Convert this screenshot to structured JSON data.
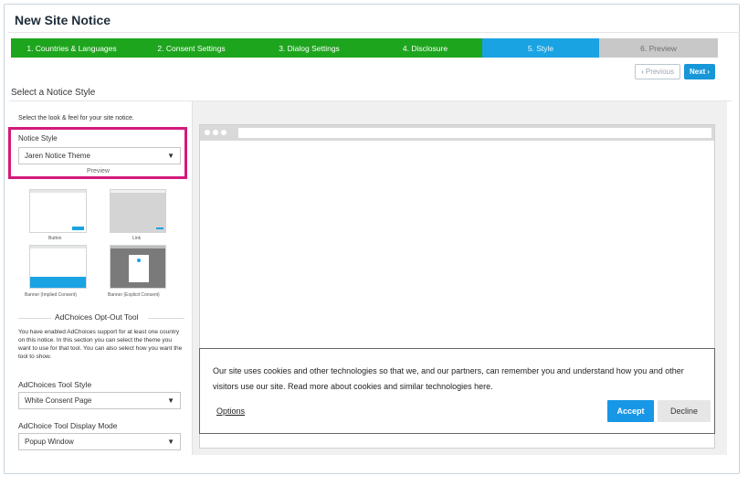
{
  "window": {
    "title": "New Site Notice"
  },
  "steps": [
    {
      "label": "1. Countries & Languages",
      "state": "done"
    },
    {
      "label": "2. Consent Settings",
      "state": "done"
    },
    {
      "label": "3. Dialog Settings",
      "state": "done"
    },
    {
      "label": "4. Disclosure",
      "state": "done"
    },
    {
      "label": "5. Style",
      "state": "active"
    },
    {
      "label": "6. Preview",
      "state": "todo"
    }
  ],
  "nav": {
    "previous_label": "Previous",
    "next_label": "Next"
  },
  "section": {
    "title": "Select a Notice Style",
    "description": "Select the look & feel for your site notice."
  },
  "notice_style": {
    "label": "Notice Style",
    "selected": "Jaren Notice Theme",
    "preview_label": "Preview",
    "thumbnails": [
      {
        "caption": "Button"
      },
      {
        "caption": "Link"
      },
      {
        "caption": "Banner (Implied Consent)"
      },
      {
        "caption": "Banner (Explicit Consent)"
      }
    ]
  },
  "adchoices": {
    "title": "AdChoices Opt-Out Tool",
    "description": "You have enabled AdChoices support for at least one country on this notice. In this section you can select the theme you want to use for that tool. You can also select how you want the tool to show.",
    "tool_style_label": "AdChoices Tool Style",
    "tool_style_value": "White Consent Page",
    "display_mode_label": "AdChoice Tool Display Mode",
    "display_mode_value": "Popup Window"
  },
  "preview": {
    "notice_text": "Our site uses cookies and other technologies so that we, and our partners, can remember you and understand how you and other visitors use our site. Read more about cookies and similar technologies here.",
    "options_label": "Options",
    "accept_label": "Accept",
    "decline_label": "Decline"
  },
  "colors": {
    "step_done": "#1ea51e",
    "step_active": "#1aa3e2",
    "step_todo": "#c8c8c8",
    "highlight": "#d4197b",
    "accept": "#1797e6"
  }
}
